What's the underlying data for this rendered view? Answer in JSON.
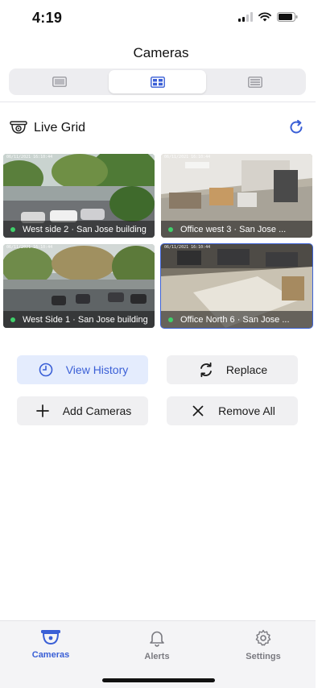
{
  "status": {
    "time": "4:19"
  },
  "nav": {
    "title": "Cameras"
  },
  "view_modes": [
    {
      "icon": "single-view-icon",
      "active": false
    },
    {
      "icon": "grid-view-icon",
      "active": true
    },
    {
      "icon": "list-view-icon",
      "active": false
    }
  ],
  "section": {
    "title": "Live Grid",
    "icon": "dome-camera-icon",
    "refresh_icon": "refresh-icon"
  },
  "cameras": [
    {
      "label": "West side 2 · San Jose building",
      "timestamp": "06/11/2021 16:10:44",
      "status": "online",
      "selected": false
    },
    {
      "label": "Office west 3 · San Jose ...",
      "timestamp": "06/11/2021 16:10:44",
      "status": "online",
      "selected": false
    },
    {
      "label": "West Side 1 · San Jose building",
      "timestamp": "06/11/2021 16:10:44",
      "status": "online",
      "selected": false
    },
    {
      "label": "Office North 6 · San Jose ...",
      "timestamp": "06/11/2021 16:10:44",
      "status": "online",
      "selected": true
    }
  ],
  "actions": {
    "view_history": "View History",
    "replace": "Replace",
    "add_cameras": "Add Cameras",
    "remove_all": "Remove All"
  },
  "tabs": [
    {
      "label": "Cameras",
      "icon": "camera-icon",
      "active": true
    },
    {
      "label": "Alerts",
      "icon": "bell-icon",
      "active": false
    },
    {
      "label": "Settings",
      "icon": "gear-icon",
      "active": false
    }
  ],
  "colors": {
    "accent": "#3a5fd6",
    "online": "#3fd06a",
    "primary_button_bg": "#e4ecfd"
  }
}
